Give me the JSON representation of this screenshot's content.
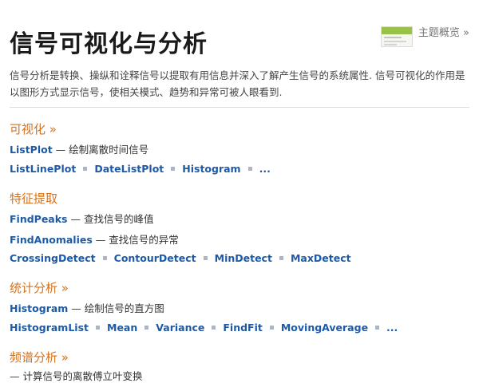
{
  "header": {
    "title": "信号可视化与分析",
    "overview_label": "主题概览 »"
  },
  "intro": "信号分析是转换、操纵和诠释信号以提取有用信息并深入了解产生信号的系统属性. 信号可视化的作用是以图形方式显示信号，使相关模式、趋势和异常可被人眼看到.",
  "sections": [
    {
      "title": "可视化 »",
      "entries": [
        {
          "fn": "ListPlot",
          "desc": " — 绘制离散时间信号"
        }
      ],
      "links": [
        "ListLinePlot",
        "DateListPlot",
        "Histogram",
        "..."
      ]
    },
    {
      "title": "特征提取",
      "entries": [
        {
          "fn": "FindPeaks",
          "desc": " — 查找信号的峰值"
        },
        {
          "fn": "FindAnomalies",
          "desc": " — 查找信号的异常"
        }
      ],
      "links": [
        "CrossingDetect",
        "ContourDetect",
        "MinDetect",
        "MaxDetect"
      ]
    },
    {
      "title": "统计分析 »",
      "entries": [
        {
          "fn": "Histogram",
          "desc": " — 绘制信号的直方图"
        }
      ],
      "links": [
        "HistogramList",
        "Mean",
        "Variance",
        "FindFit",
        "MovingAverage",
        "..."
      ]
    },
    {
      "title": "频谱分析 »",
      "entries": [
        {
          "fn": "",
          "desc": "— 计算信号的离散傅立叶变换"
        }
      ],
      "links": []
    }
  ]
}
